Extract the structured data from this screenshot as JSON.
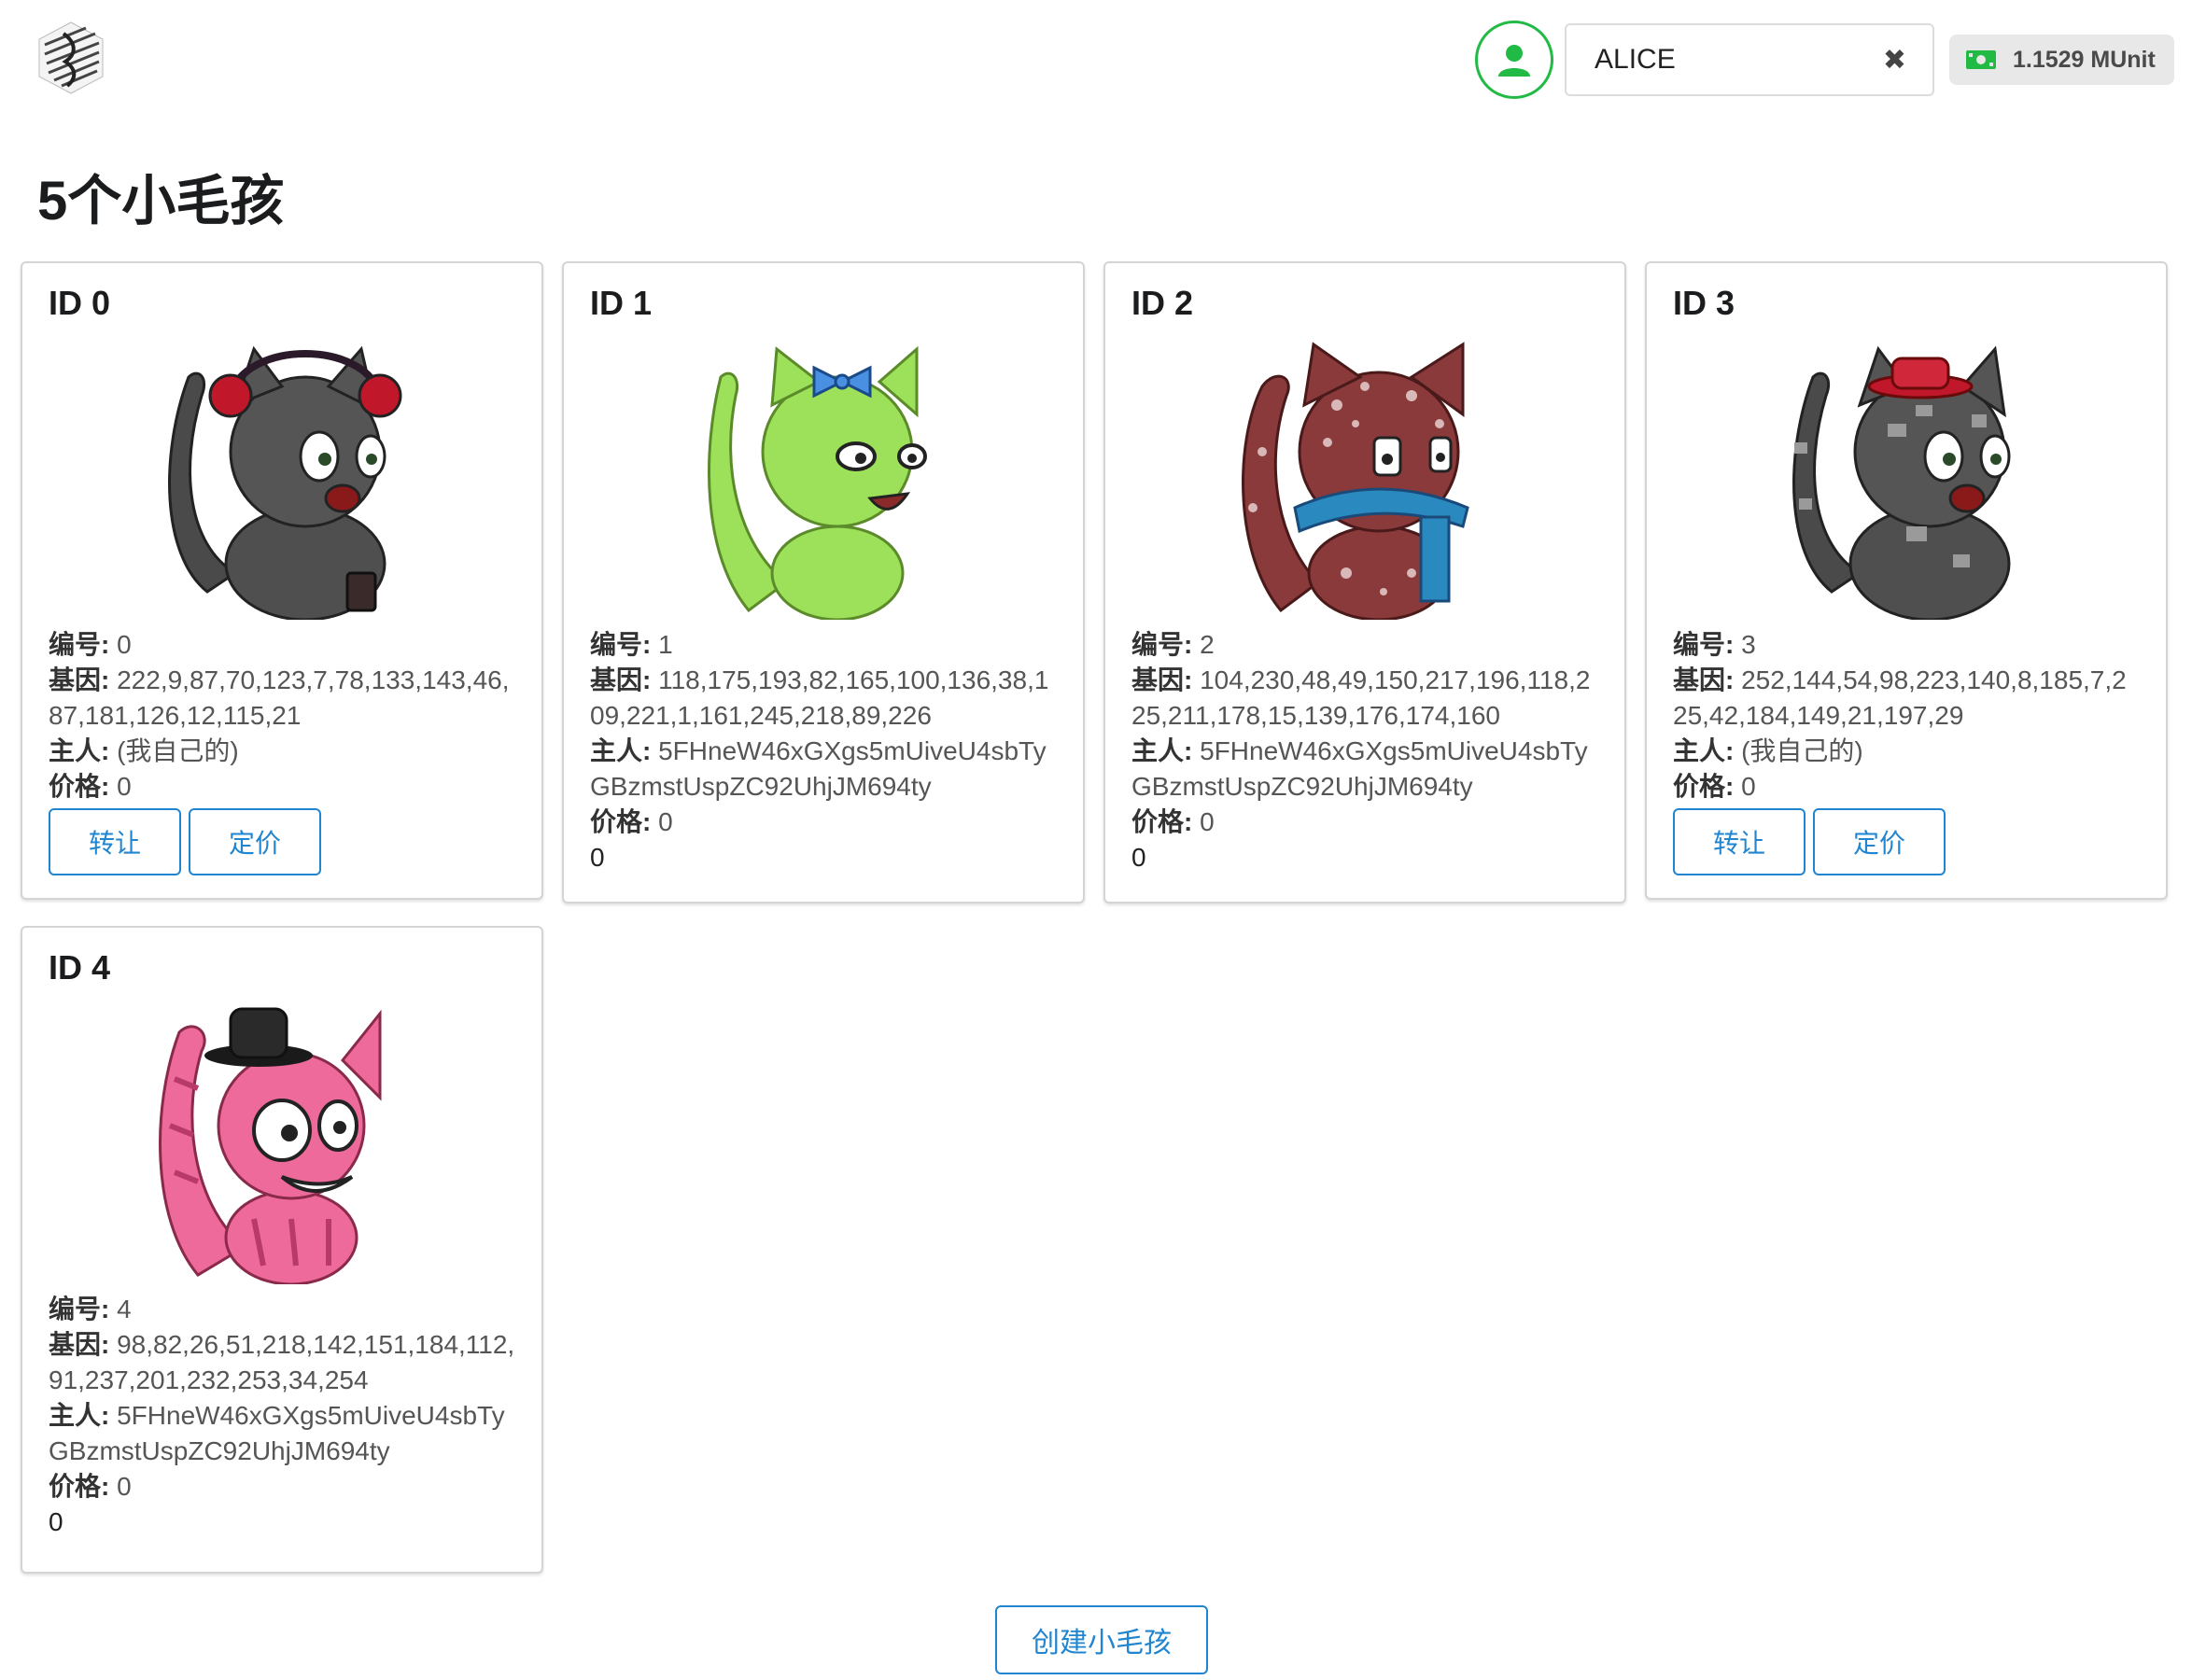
{
  "header": {
    "account_name": "ALICE",
    "clear_glyph": "✖",
    "balance": "1.1529 MUnit"
  },
  "page": {
    "title": "5个小毛孩"
  },
  "labels": {
    "number": "编号:",
    "genes": "基因:",
    "owner": "主人:",
    "price": "价格:",
    "transfer_button": "转让",
    "set_price_button": "定价"
  },
  "kitties": [
    {
      "id_title": "ID 0",
      "number": "0",
      "genes": "222,9,87,70,123,7,78,133,143,46,87,181,126,12,115,21",
      "owner": "(我自己的)",
      "price": "0",
      "mine": true,
      "art": "grey-cat-headphones"
    },
    {
      "id_title": "ID 1",
      "number": "1",
      "genes": "118,175,193,82,165,100,136,38,109,221,1,161,245,218,89,226",
      "owner": "5FHneW46xGXgs5mUiveU4sbTyGBzmstUspZC92UhjJM694ty",
      "price": "0",
      "extra": "0",
      "mine": false,
      "art": "green-cat-bow"
    },
    {
      "id_title": "ID 2",
      "number": "2",
      "genes": "104,230,48,49,150,217,196,118,225,211,178,15,139,176,174,160",
      "owner": "5FHneW46xGXgs5mUiveU4sbTyGBzmstUspZC92UhjJM694ty",
      "price": "0",
      "extra": "0",
      "mine": false,
      "art": "red-spotted-cat-scarf"
    },
    {
      "id_title": "ID 3",
      "number": "3",
      "genes": "252,144,54,98,223,140,8,185,7,225,42,184,149,21,197,29",
      "owner": "(我自己的)",
      "price": "0",
      "mine": true,
      "art": "grey-cat-red-hat"
    },
    {
      "id_title": "ID 4",
      "number": "4",
      "genes": "98,82,26,51,218,142,151,184,112,91,237,201,232,253,34,254",
      "owner": "5FHneW46xGXgs5mUiveU4sbTyGBzmstUspZC92UhjJM694ty",
      "price": "0",
      "extra": "0",
      "mine": false,
      "art": "pink-cat-black-hat"
    }
  ],
  "footer": {
    "create_button": "创建小毛孩"
  },
  "colors": {
    "accent": "#2185d0",
    "online": "#21ba45",
    "balance_icon": "#21ba45"
  }
}
